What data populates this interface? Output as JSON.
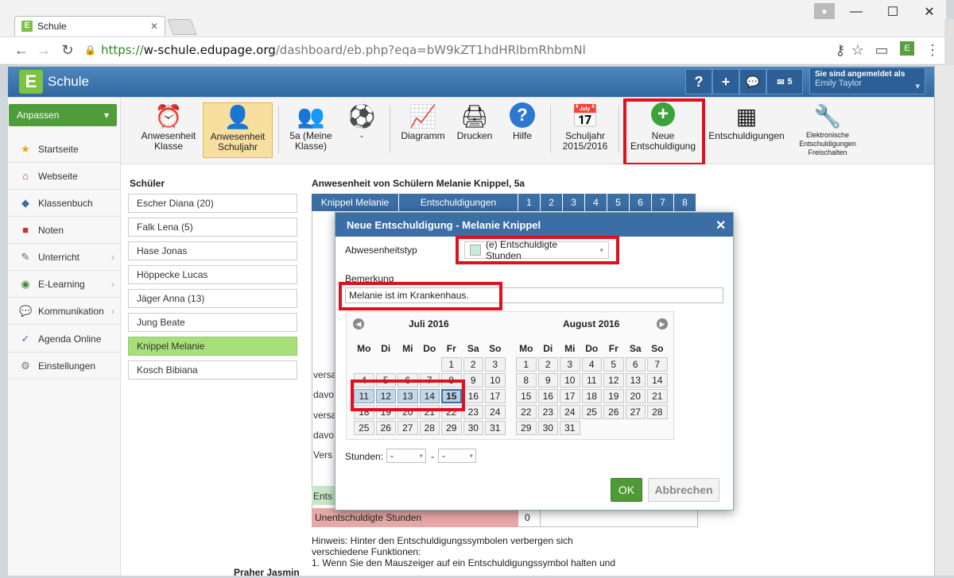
{
  "browser": {
    "tab_title": "Schule",
    "url_https": "https://",
    "url_host": "w-schule.edupage.org",
    "url_path": "/dashboard/eb.php?eqa=bW9kZT1hdHRlbmRhbmNl"
  },
  "app": {
    "name": "Schule",
    "logo_letter": "E",
    "header_buttons": [
      "?",
      "+"
    ],
    "mail_count": "5",
    "logged_in_label": "Sie sind angemeldet als",
    "user": "Emily Taylor"
  },
  "sidebar": {
    "customize": "Anpassen",
    "items": [
      {
        "label": "Startseite",
        "icon": "star-icon"
      },
      {
        "label": "Webseite",
        "icon": "house-icon"
      },
      {
        "label": "Klassenbuch",
        "icon": "book-icon"
      },
      {
        "label": "Noten",
        "icon": "grades-icon"
      },
      {
        "label": "Unterricht",
        "icon": "pen-icon"
      },
      {
        "label": "E-Learning",
        "icon": "elearning-icon"
      },
      {
        "label": "Kommunikation",
        "icon": "chat-icon"
      },
      {
        "label": "Agenda Online",
        "icon": "agenda-icon"
      },
      {
        "label": "Einstellungen",
        "icon": "settings-icon"
      }
    ]
  },
  "ribbon": {
    "items": [
      {
        "l1": "Anwesenheit",
        "l2": "Klasse"
      },
      {
        "l1": "Anwesenheit",
        "l2": "Schuljahr"
      },
      {
        "l1": "5a (Meine",
        "l2": "Klasse)"
      },
      {
        "l1": "-",
        "l2": ""
      },
      {
        "l1": "Diagramm",
        "l2": ""
      },
      {
        "l1": "Drucken",
        "l2": ""
      },
      {
        "l1": "Hilfe",
        "l2": ""
      },
      {
        "l1": "Schuljahr",
        "l2": "2015/2016"
      },
      {
        "l1": "Neue",
        "l2": "Entschuldigung"
      },
      {
        "l1": "Entschuldigungen",
        "l2": ""
      },
      {
        "l1": "Elektronische",
        "l2": "Entschuldigungen",
        "l3": "Freischalten"
      }
    ]
  },
  "students": {
    "title": "Schüler",
    "list": [
      "Escher Diana (20)",
      "Falk Lena (5)",
      "Hase Jonas",
      "Höppecke Lucas",
      "Jäger Anna (13)",
      "Jung Beate",
      "Knippel Melanie",
      "Kosch Bibiana"
    ]
  },
  "attendance": {
    "title": "Anwesenheit von Schülern Melanie Knippel, 5a",
    "col_name": "Knippel Melanie",
    "col_exc": "Entschuldigungen",
    "periods": [
      "1",
      "2",
      "3",
      "4",
      "5",
      "6",
      "7",
      "8"
    ],
    "row_labels": [
      "versa",
      "davo",
      "versa",
      "davo",
      "Vers",
      "Ents"
    ],
    "unexcused_label": "Unentschuldigte Stunden",
    "unexcused_value": "0",
    "hint": "Hinweis: Hinter den Entschuldigungssymbolen verbergen sich verschiedene Funktionen:",
    "hint2": "1. Wenn Sie den Mauszeiger auf ein Entschuldigungssymbol halten und",
    "bottom_name": "Praher Jasmin"
  },
  "dialog": {
    "title": "Neue Entschuldigung - Melanie Knippel",
    "type_label": "Abwesenheitstyp",
    "type_value": "(e) Entschuldigte Stunden",
    "remark_label": "Bemerkung",
    "remark_value": "Melanie ist im Krankenhaus.",
    "month1": "Juli 2016",
    "month2": "August 2016",
    "weekdays": [
      "Mo",
      "Di",
      "Mi",
      "Do",
      "Fr",
      "Sa",
      "So"
    ],
    "hours_label": "Stunden:",
    "hours_from": "-",
    "hours_to": "-",
    "ok": "OK",
    "cancel": "Abbrechen"
  },
  "colors": {
    "header": "#3a6ea5",
    "accent_green": "#4f9c3a",
    "highlight": "#e0101e"
  }
}
